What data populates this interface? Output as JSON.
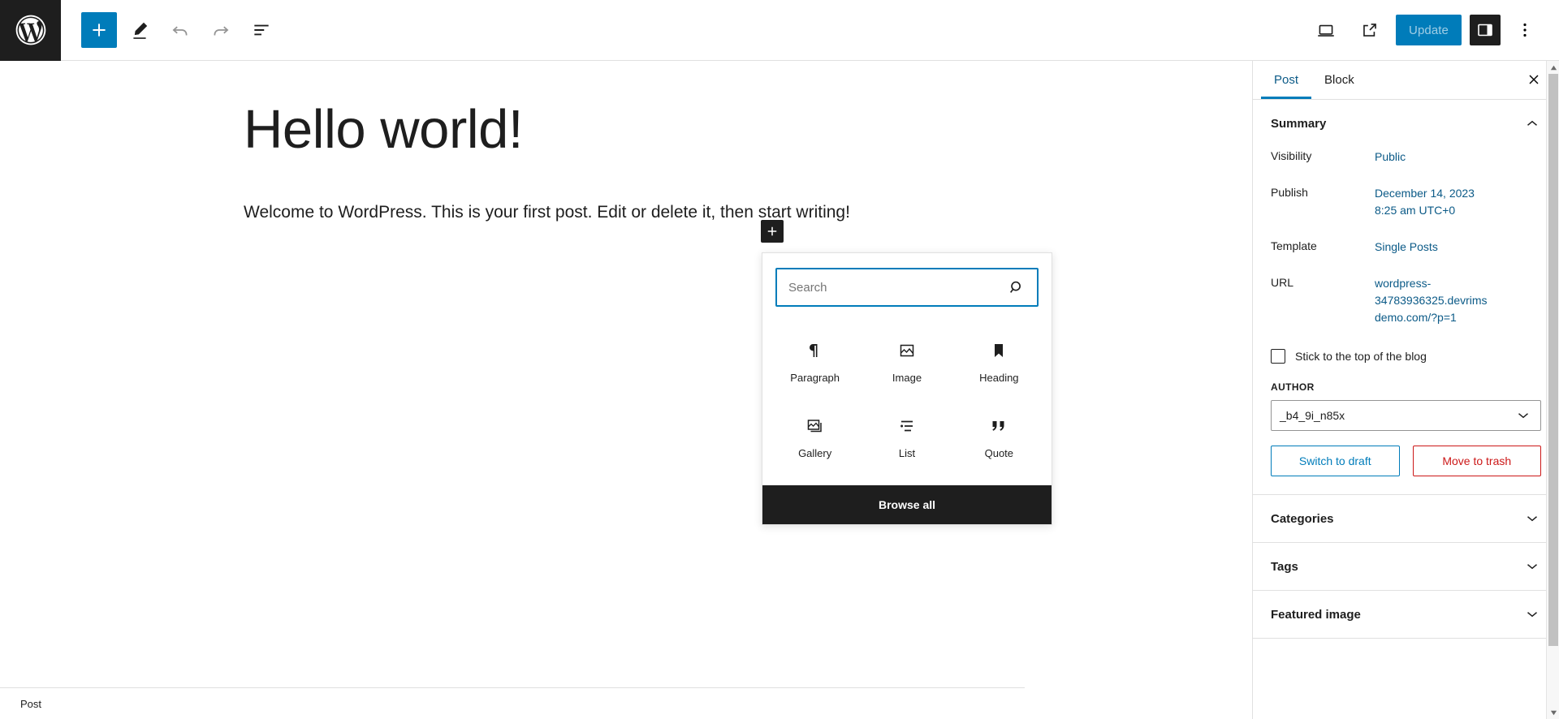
{
  "header": {
    "logo_name": "wordpress-logo",
    "add_block_label": "+",
    "tools": {
      "add": "Add block",
      "edit": "Tools",
      "undo": "Undo",
      "redo": "Redo",
      "list_view": "Document Overview"
    },
    "right": {
      "preview": "View",
      "view_site": "View Post",
      "update_label": "Update",
      "settings": "Settings",
      "options": "Options"
    }
  },
  "editor": {
    "title": "Hello world!",
    "paragraph": "Welcome to WordPress. This is your first post. Edit or delete it, then start writing!",
    "inline_inserter_label": "+"
  },
  "footer": {
    "breadcrumb": "Post"
  },
  "inserter": {
    "search_placeholder": "Search",
    "search_value": "",
    "browse_all": "Browse all",
    "blocks": [
      {
        "label": "Paragraph",
        "icon": "paragraph-icon"
      },
      {
        "label": "Image",
        "icon": "image-icon"
      },
      {
        "label": "Heading",
        "icon": "heading-icon"
      },
      {
        "label": "Gallery",
        "icon": "gallery-icon"
      },
      {
        "label": "List",
        "icon": "list-icon"
      },
      {
        "label": "Quote",
        "icon": "quote-icon"
      }
    ]
  },
  "sidebar": {
    "tabs": [
      {
        "label": "Post",
        "active": true
      },
      {
        "label": "Block",
        "active": false
      }
    ],
    "close_label": "Close Settings",
    "summary": {
      "title": "Summary",
      "rows": [
        {
          "label": "Visibility",
          "value": "Public"
        },
        {
          "label": "Publish",
          "value": "December 14, 2023 8:25 am UTC+0"
        },
        {
          "label": "Template",
          "value": "Single Posts"
        },
        {
          "label": "URL",
          "value": "wordpress-34783936325.devrimsdemo.com/?p=1"
        }
      ],
      "sticky_label": "Stick to the top of the blog",
      "author_label": "AUTHOR",
      "author_value": "_b4_9i_n85x",
      "switch_draft": "Switch to draft",
      "move_trash": "Move to trash"
    },
    "panels": [
      {
        "label": "Categories"
      },
      {
        "label": "Tags"
      },
      {
        "label": "Featured image"
      }
    ]
  },
  "colors": {
    "accent": "#007cba",
    "dark": "#1e1e1e",
    "link": "#0b5a87",
    "danger": "#cc1818"
  }
}
